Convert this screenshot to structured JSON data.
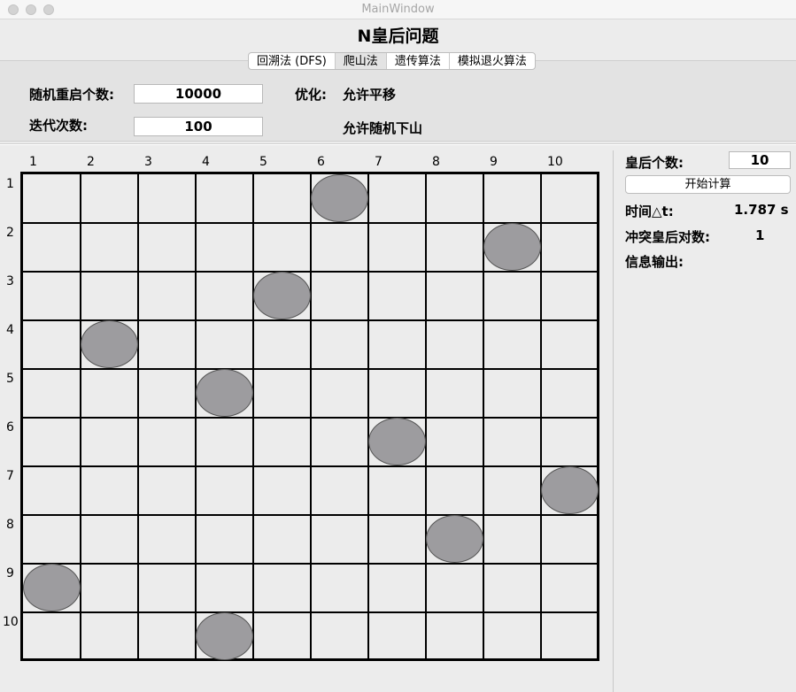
{
  "window": {
    "title": "MainWindow"
  },
  "app_title": "N皇后问题",
  "tabs": [
    {
      "label": "回溯法 (DFS)"
    },
    {
      "label": "爬山法"
    },
    {
      "label": "遗传算法"
    },
    {
      "label": "模拟退火算法"
    }
  ],
  "params": {
    "restart_label": "随机重启个数:",
    "restart_value": "10000",
    "iter_label": "迭代次数:",
    "iter_value": "100",
    "opt_label": "优化:",
    "opt_sideways": "允许平移",
    "opt_random_downhill": "允许随机下山"
  },
  "board": {
    "n": 10,
    "col_labels": [
      "1",
      "2",
      "3",
      "4",
      "5",
      "6",
      "7",
      "8",
      "9",
      "10"
    ],
    "row_labels": [
      "1",
      "2",
      "3",
      "4",
      "5",
      "6",
      "7",
      "8",
      "9",
      "10"
    ],
    "queen_columns": [
      6,
      9,
      5,
      2,
      4,
      7,
      10,
      8,
      1,
      4
    ]
  },
  "side": {
    "queen_count_label": "皇后个数:",
    "queen_count_value": "10",
    "start_button": "开始计算",
    "time_label": "时间△t:",
    "time_value": "1.787  s",
    "conflict_label": "冲突皇后对数:",
    "conflict_value": "1",
    "info_label": "信息输出:"
  }
}
